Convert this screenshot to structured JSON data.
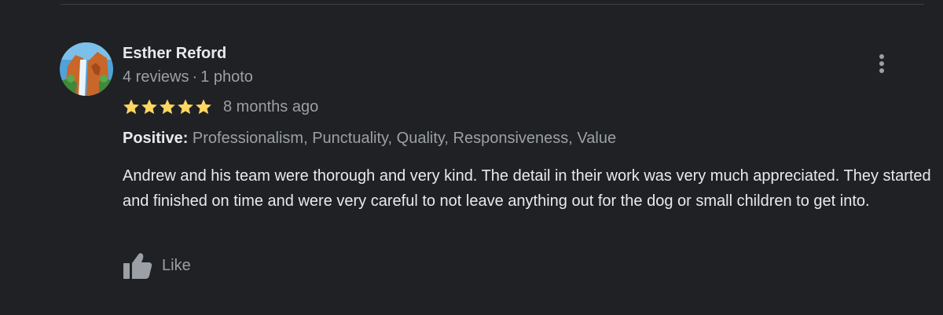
{
  "review": {
    "author_name": "Esther Reford",
    "reviews_count": "4 reviews",
    "separator": "·",
    "photos_count": "1 photo",
    "rating": 5,
    "rating_max": 5,
    "date": "8 months ago",
    "attributes_label": "Positive:",
    "attributes_values": "Professionalism, Punctuality, Quality, Responsiveness, Value",
    "text": "Andrew and his team were thorough and very kind. The detail in their work was very much appreciated. They started and finished on time and were very careful to not leave anything out for the dog or small children to get into.",
    "like_label": "Like"
  },
  "colors": {
    "background": "#202124",
    "star": "#fdd663",
    "primary_text": "#e8eaed",
    "secondary_text": "#9aa0a6"
  },
  "icons": {
    "avatar": "avatar-photo",
    "star": "star-icon",
    "like": "thumbs-up-icon",
    "more": "more-vertical-icon"
  }
}
